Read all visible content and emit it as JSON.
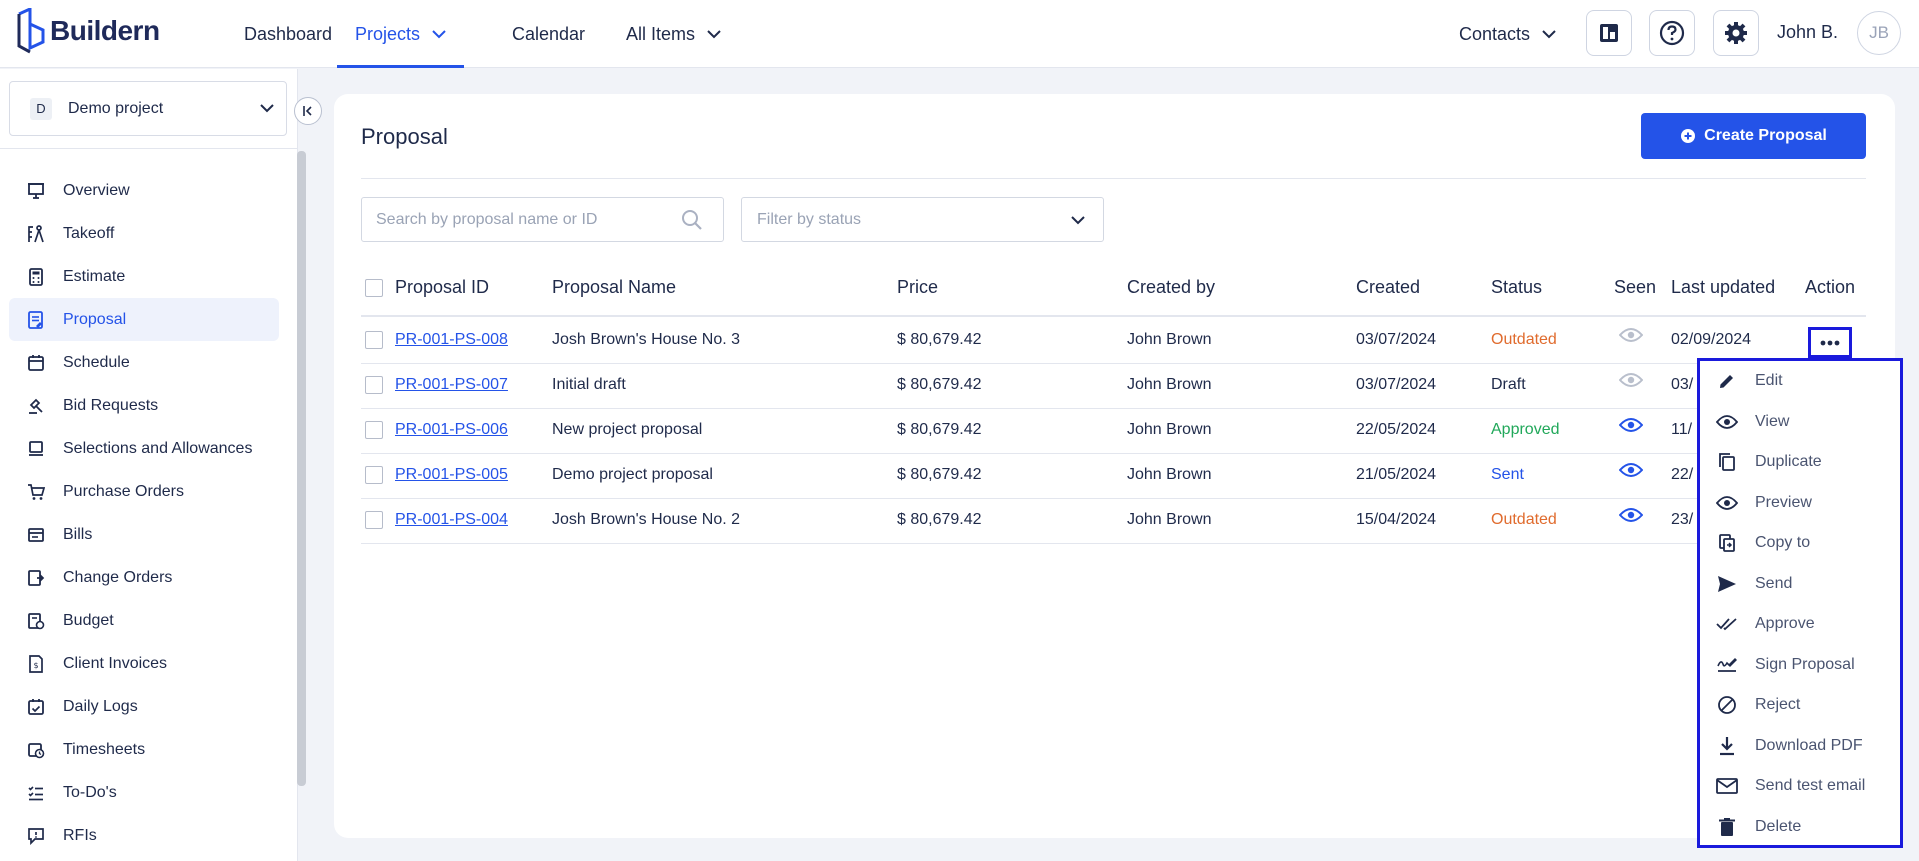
{
  "brand": {
    "name": "Buildern"
  },
  "topnav": {
    "items": [
      {
        "label": "Dashboard"
      },
      {
        "label": "Projects"
      },
      {
        "label": "Calendar"
      },
      {
        "label": "All Items"
      }
    ],
    "contacts_label": "Contacts",
    "user_name": "John B.",
    "avatar_initials": "JB"
  },
  "sidebar": {
    "project": {
      "badge": "D",
      "name": "Demo project"
    },
    "items": [
      {
        "label": "Overview",
        "icon": "presentation-icon"
      },
      {
        "label": "Takeoff",
        "icon": "takeoff-icon"
      },
      {
        "label": "Estimate",
        "icon": "calculator-icon"
      },
      {
        "label": "Proposal",
        "icon": "proposal-icon"
      },
      {
        "label": "Schedule",
        "icon": "calendar-icon"
      },
      {
        "label": "Bid Requests",
        "icon": "bid-icon"
      },
      {
        "label": "Selections and Allowances",
        "icon": "selections-icon"
      },
      {
        "label": "Purchase Orders",
        "icon": "cart-icon"
      },
      {
        "label": "Bills",
        "icon": "bills-icon"
      },
      {
        "label": "Change Orders",
        "icon": "change-orders-icon"
      },
      {
        "label": "Budget",
        "icon": "budget-icon"
      },
      {
        "label": "Client Invoices",
        "icon": "invoice-icon"
      },
      {
        "label": "Daily Logs",
        "icon": "daily-logs-icon"
      },
      {
        "label": "Timesheets",
        "icon": "timesheets-icon"
      },
      {
        "label": "To-Do's",
        "icon": "todo-icon"
      },
      {
        "label": "RFIs",
        "icon": "rfi-icon"
      }
    ],
    "active_index": 3
  },
  "page": {
    "title": "Proposal",
    "create_button": "Create Proposal",
    "search_placeholder": "Search by proposal name or ID",
    "filter_placeholder": "Filter by status"
  },
  "table": {
    "columns": [
      "Proposal ID",
      "Proposal Name",
      "Price",
      "Created by",
      "Created",
      "Status",
      "Seen",
      "Last updated",
      "Action"
    ],
    "rows": [
      {
        "id": "PR-001-PS-008",
        "name": "Josh Brown's House No. 3",
        "price": "$ 80,679.42",
        "created_by": "John Brown",
        "created": "03/07/2024",
        "status": "Outdated",
        "status_class": "outdated",
        "seen": false,
        "updated": "02/09/2024"
      },
      {
        "id": "PR-001-PS-007",
        "name": "Initial draft",
        "price": "$ 80,679.42",
        "created_by": "John Brown",
        "created": "03/07/2024",
        "status": "Draft",
        "status_class": "draft",
        "seen": false,
        "updated": "03/"
      },
      {
        "id": "PR-001-PS-006",
        "name": "New project proposal",
        "price": "$ 80,679.42",
        "created_by": "John Brown",
        "created": "22/05/2024",
        "status": "Approved",
        "status_class": "approved",
        "seen": true,
        "updated": "11/"
      },
      {
        "id": "PR-001-PS-005",
        "name": "Demo project proposal",
        "price": "$ 80,679.42",
        "created_by": "John Brown",
        "created": "21/05/2024",
        "status": "Sent",
        "status_class": "sent",
        "seen": true,
        "updated": "22/"
      },
      {
        "id": "PR-001-PS-004",
        "name": "Josh Brown's House No. 2",
        "price": "$ 80,679.42",
        "created_by": "John Brown",
        "created": "15/04/2024",
        "status": "Outdated",
        "status_class": "outdated",
        "seen": true,
        "updated": "23/"
      }
    ]
  },
  "action_menu": {
    "items": [
      {
        "label": "Edit",
        "icon": "pencil-icon"
      },
      {
        "label": "View",
        "icon": "eye-icon"
      },
      {
        "label": "Duplicate",
        "icon": "duplicate-icon"
      },
      {
        "label": "Preview",
        "icon": "preview-icon"
      },
      {
        "label": "Copy to",
        "icon": "copy-to-icon"
      },
      {
        "label": "Send",
        "icon": "send-icon"
      },
      {
        "label": "Approve",
        "icon": "double-check-icon"
      },
      {
        "label": "Sign Proposal",
        "icon": "signature-icon"
      },
      {
        "label": "Reject",
        "icon": "reject-icon"
      },
      {
        "label": "Download PDF",
        "icon": "download-icon"
      },
      {
        "label": "Send test email",
        "icon": "mail-icon"
      },
      {
        "label": "Delete",
        "icon": "trash-icon"
      }
    ]
  },
  "colors": {
    "accent": "#2453e8",
    "highlight": "#1a1adc",
    "outdated": "#e06b2d",
    "approved": "#21a85a"
  }
}
